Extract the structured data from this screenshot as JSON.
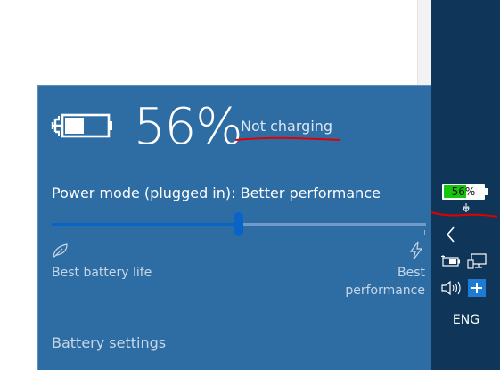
{
  "flyout": {
    "percent": "56%",
    "status": "Not charging",
    "power_mode": "Power mode (plugged in): Better performance",
    "slider_level": 0.5,
    "slider_min_label": "Best battery life",
    "slider_max_label": "Best performance",
    "battery_settings_link": "Battery settings",
    "icons": {
      "battery": "battery-plugged-icon",
      "left_end": "leaf-icon",
      "right_end": "lightning-bolt-icon"
    }
  },
  "taskbar": {
    "battery_percent": "56%",
    "battery_level": 0.56,
    "battery_color": "#16c60c",
    "language": "ENG",
    "icons": [
      "chevron-left-icon",
      "battery-icon",
      "network-icon",
      "volume-icon",
      "plus-icon"
    ]
  },
  "colors": {
    "flyout_bg": "#2e6da4",
    "taskbar_bg": "#0f3559",
    "slider_accent": "#0a64c8",
    "annotation": "#e00000"
  }
}
